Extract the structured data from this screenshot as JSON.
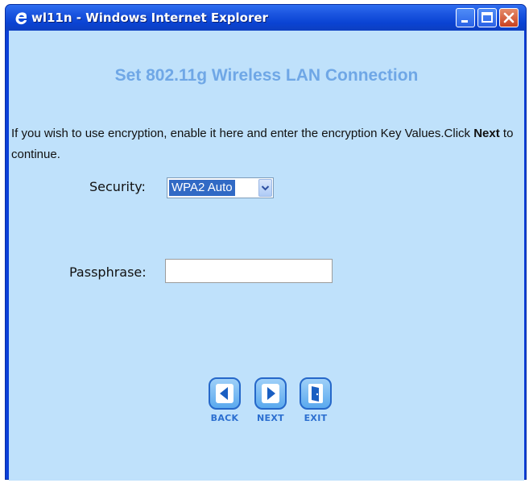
{
  "window": {
    "title": "wl11n - Windows Internet Explorer"
  },
  "page": {
    "heading": "Set 802.11g Wireless LAN Connection",
    "info_part1": "If you wish to use encryption, enable it here and enter the encryption Key Values.Click ",
    "info_bold": "Next",
    "info_part2": " to continue."
  },
  "form": {
    "security_label": "Security:",
    "security_value": "WPA2 Auto",
    "passphrase_label": "Passphrase:",
    "passphrase_value": ""
  },
  "nav": {
    "back_label": "BACK",
    "next_label": "NEXT",
    "exit_label": "EXIT"
  },
  "colors": {
    "content_bg": "#bfe1fb",
    "heading": "#6fa7e6",
    "titlebar": "#0a43d3",
    "nav_label": "#2c6fd0"
  }
}
